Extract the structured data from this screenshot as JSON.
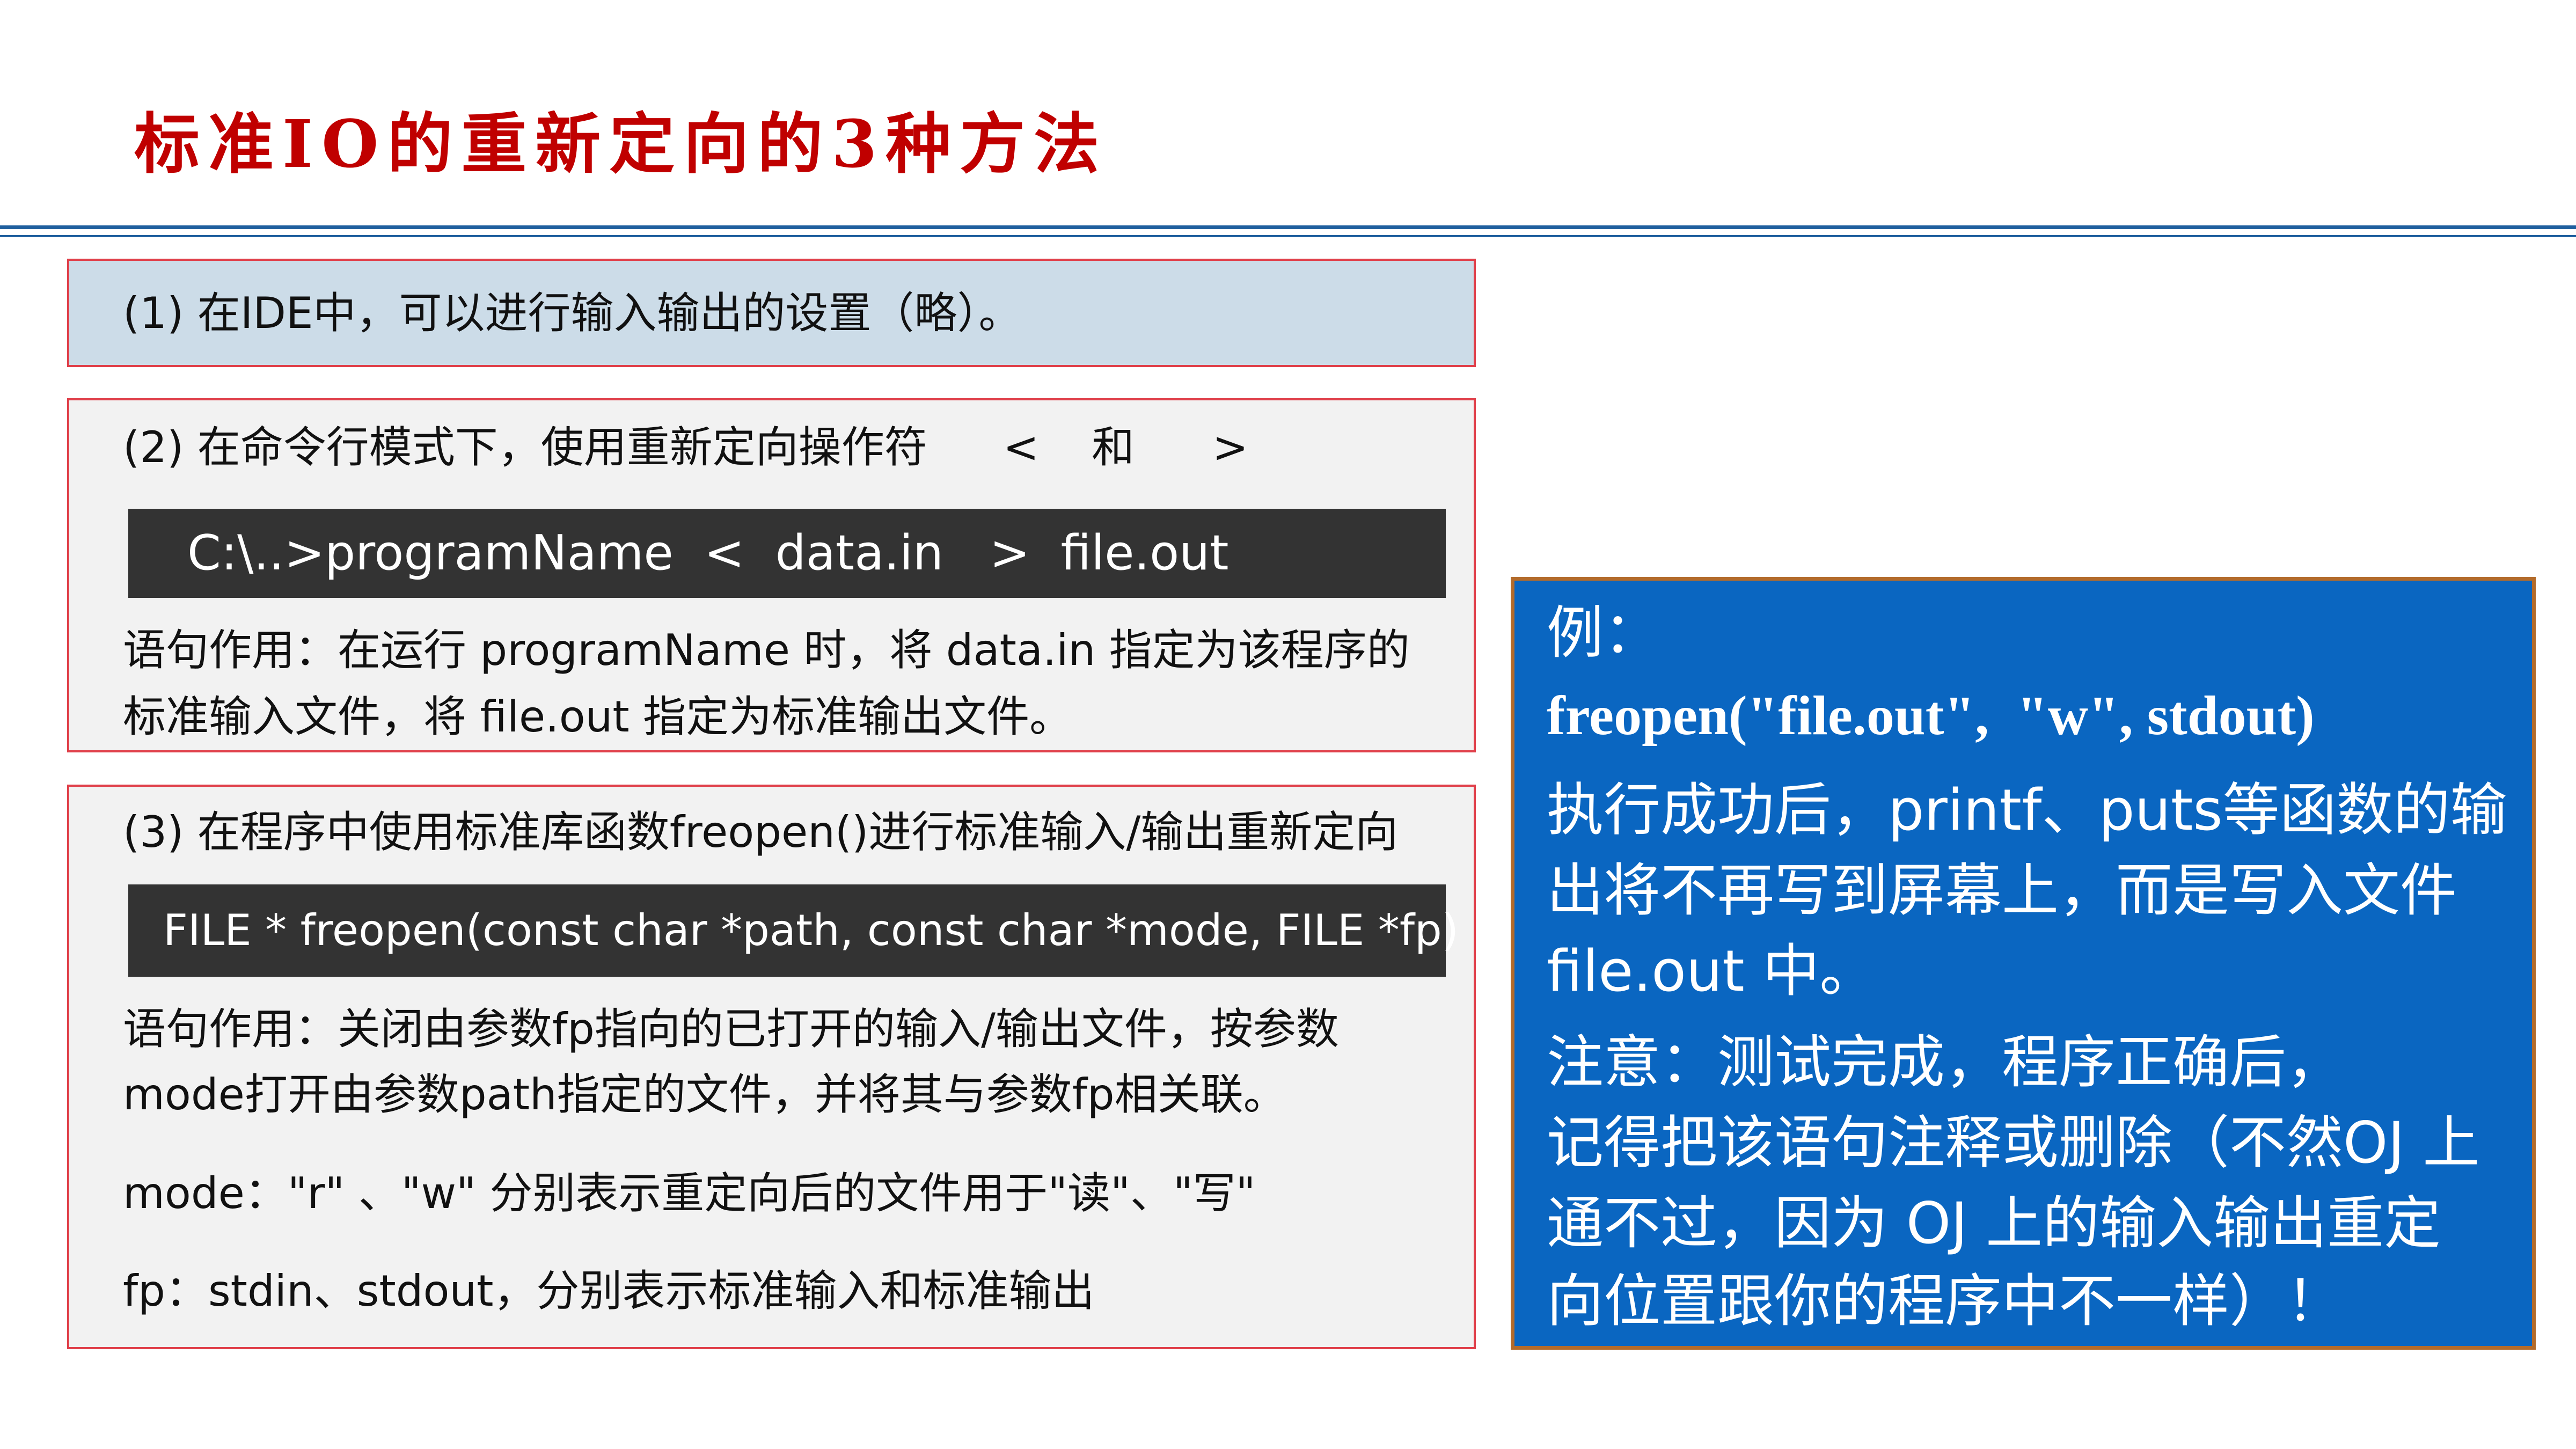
{
  "title": "标准IO的重新定向的3种方法",
  "box1": {
    "text": "(1) 在IDE中，可以进行输入输出的设置（略）。"
  },
  "box2": {
    "heading": "(2) 在命令行模式下，使用重新定向操作符",
    "op_lt": "<",
    "op_and": "和",
    "op_gt": ">",
    "command": "C:\\..>programName  <  data.in   >  file.out",
    "desc_line1": "语句作用：在运行 programName 时，将 data.in 指定为该程序的",
    "desc_line2": "标准输入文件，将 file.out 指定为标准输出文件。"
  },
  "box3": {
    "heading": "(3) 在程序中使用标准库函数freopen()进行标准输入/输出重新定向",
    "signature": "FILE * freopen(const char *path, const char *mode, FILE *fp)",
    "desc_line1": "语句作用：关闭由参数fp指向的已打开的输入/输出文件，按参数",
    "desc_line2": "mode打开由参数path指定的文件，并将其与参数fp相关联。",
    "mode_line": "mode：\"r\" 、\"w\" 分别表示重定向后的文件用于\"读\"、\"写\"",
    "fp_line": "fp：stdin、stdout，分别表示标准输入和标准输出"
  },
  "example": {
    "label": "例：",
    "code": "freopen(\"file.out\",  \"w\", stdout)",
    "line1": "执行成功后，printf、puts等函数的输",
    "line2": "出将不再写到屏幕上，而是写入文件",
    "line3": "file.out 中。",
    "line4": "注意：测试完成，程序正确后，",
    "line5": "记得把该语句注释或删除（不然OJ 上",
    "line6": "通不过，因为 OJ 上的输入输出重定",
    "line7": "向位置跟你的程序中不一样）！"
  },
  "colors": {
    "title": "#c00000",
    "rule": "#1f5f9e",
    "box_border": "#e0404a",
    "box1_bg": "#ccdce8",
    "box_bg": "#f2f2f2",
    "code_bg": "#333333",
    "panel_bg": "#0a66c1",
    "panel_border": "#b36b2b"
  }
}
